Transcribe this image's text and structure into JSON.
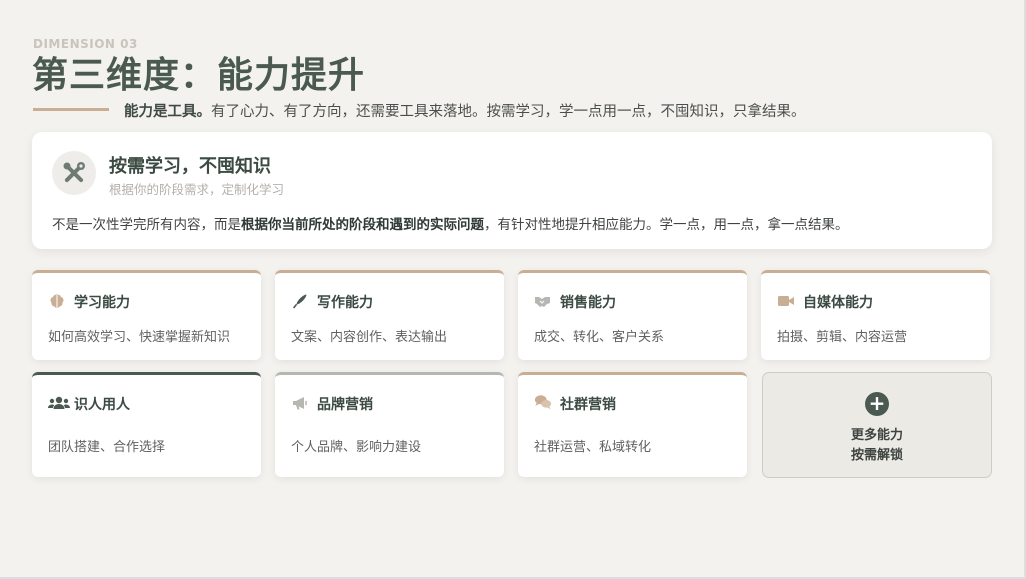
{
  "header": {
    "kicker": "DIMENSION 03",
    "title": "第三维度：能力提升",
    "lead_bold": "能力是工具。",
    "lead_rest": "有了心力、有了方向，还需要工具来落地。按需学习，学一点用一点，不囤知识，只拿结果。"
  },
  "hero": {
    "icon": "tools-icon",
    "title": "按需学习，不囤知识",
    "subtitle": "根据你的阶段需求，定制化学习",
    "body_1": "不是一次性学完所有内容，而是",
    "body_bold": "根据你当前所处的阶段和遇到的实际问题",
    "body_2": "，有针对性地提升相应能力。学一点，用一点，拿一点结果。"
  },
  "cards": [
    {
      "title": "学习能力",
      "desc": "如何高效学习、快速掌握新知识",
      "icon": "brain-icon",
      "accent": "#c9ae93"
    },
    {
      "title": "写作能力",
      "desc": "文案、内容创作、表达输出",
      "icon": "pen-icon",
      "accent": "#4a5a51"
    },
    {
      "title": "销售能力",
      "desc": "成交、转化、客户关系",
      "icon": "handshake-icon",
      "accent": "#b5b8b2"
    },
    {
      "title": "自媒体能力",
      "desc": "拍摄、剪辑、内容运营",
      "icon": "video-camera-icon",
      "accent": "#c9ae93"
    },
    {
      "title": "识人用人",
      "desc": "团队搭建、合作选择",
      "icon": "users-icon",
      "accent": "#4a5a51"
    },
    {
      "title": "品牌营销",
      "desc": "个人品牌、影响力建设",
      "icon": "megaphone-icon",
      "accent": "#b5b8b2"
    },
    {
      "title": "社群营销",
      "desc": "社群运营、私域转化",
      "icon": "comments-icon",
      "accent": "#c9ae93"
    }
  ],
  "more": {
    "icon": "plus-icon",
    "line1": "更多能力",
    "line2": "按需解锁"
  },
  "colors": {
    "background": "#f4f2ee",
    "primary": "#4a5a51",
    "accent_tan": "#c9ae93",
    "accent_gray": "#b5b8b2"
  }
}
